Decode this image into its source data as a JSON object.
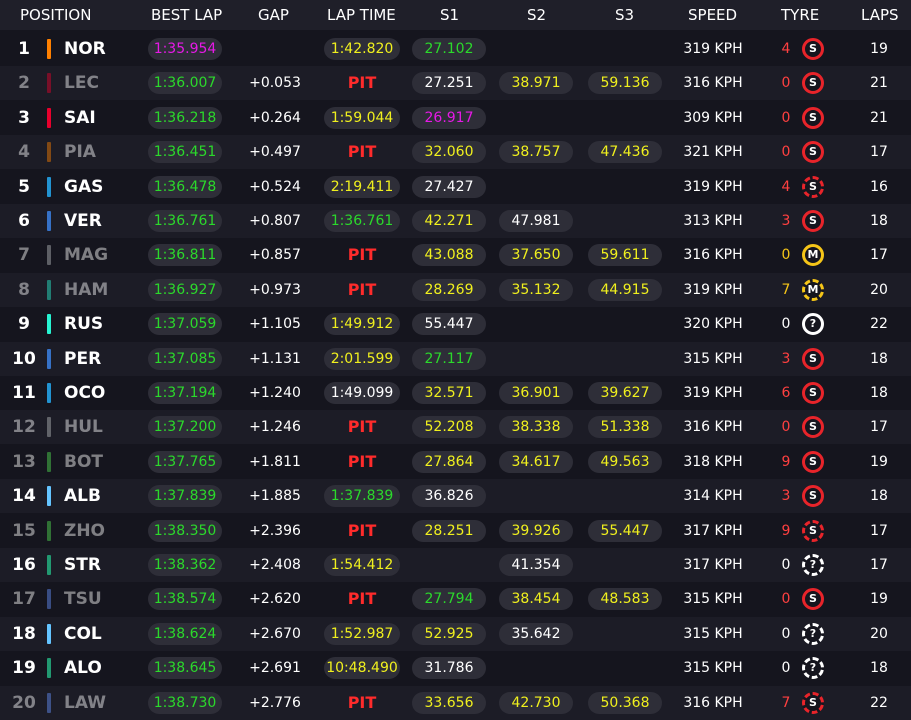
{
  "colors": {
    "purple": "#e619e6",
    "green": "#2bd92b",
    "yellow": "#f0f01e",
    "white": "#ffffff",
    "pit_red": "#ff2b2b",
    "soft": "#e8242a",
    "medium": "#f5c518",
    "unknown": "#ffffff"
  },
  "headers": {
    "position": "POSITION",
    "best_lap": "BEST LAP",
    "gap": "GAP",
    "lap_time": "LAP TIME",
    "s1": "S1",
    "s2": "S2",
    "s3": "S3",
    "speed": "SPEED",
    "tyre": "TYRE",
    "laps": "LAPS"
  },
  "rows": [
    {
      "pos": "1",
      "code": "NOR",
      "team_color": "#ff8000",
      "faded": false,
      "best_lap": "1:35.954",
      "best_lap_color": "purple",
      "gap": "",
      "lap_time": "1:42.820",
      "lap_time_color": "yellow",
      "pit": "",
      "s1": "27.102",
      "s1_color": "green",
      "s2": "",
      "s2_color": "white",
      "s3": "",
      "s3_color": "white",
      "speed": "319 KPH",
      "tyre_age": "4",
      "tyre_age_color": "#ff4040",
      "tyre": "S",
      "tyre_type": "soft",
      "tyre_status": "full",
      "laps": "19"
    },
    {
      "pos": "2",
      "code": "LEC",
      "team_color": "#e8002d",
      "faded": true,
      "best_lap": "1:36.007",
      "best_lap_color": "green",
      "gap": "+0.053",
      "lap_time": "",
      "lap_time_color": "white",
      "pit": "PIT",
      "s1": "27.251",
      "s1_color": "white",
      "s2": "38.971",
      "s2_color": "yellow",
      "s3": "59.136",
      "s3_color": "yellow",
      "speed": "316 KPH",
      "tyre_age": "0",
      "tyre_age_color": "#ff4040",
      "tyre": "S",
      "tyre_type": "soft",
      "tyre_status": "full",
      "laps": "21"
    },
    {
      "pos": "3",
      "code": "SAI",
      "team_color": "#e8002d",
      "faded": false,
      "best_lap": "1:36.218",
      "best_lap_color": "green",
      "gap": "+0.264",
      "lap_time": "1:59.044",
      "lap_time_color": "yellow",
      "pit": "",
      "s1": "26.917",
      "s1_color": "purple",
      "s2": "",
      "s2_color": "white",
      "s3": "",
      "s3_color": "white",
      "speed": "309 KPH",
      "tyre_age": "0",
      "tyre_age_color": "#ff4040",
      "tyre": "S",
      "tyre_type": "soft",
      "tyre_status": "full",
      "laps": "21"
    },
    {
      "pos": "4",
      "code": "PIA",
      "team_color": "#ff8000",
      "faded": true,
      "best_lap": "1:36.451",
      "best_lap_color": "green",
      "gap": "+0.497",
      "lap_time": "",
      "lap_time_color": "white",
      "pit": "PIT",
      "s1": "32.060",
      "s1_color": "yellow",
      "s2": "38.757",
      "s2_color": "yellow",
      "s3": "47.436",
      "s3_color": "yellow",
      "speed": "321 KPH",
      "tyre_age": "0",
      "tyre_age_color": "#ff4040",
      "tyre": "S",
      "tyre_type": "soft",
      "tyre_status": "full",
      "laps": "17"
    },
    {
      "pos": "5",
      "code": "GAS",
      "team_color": "#2293d1",
      "faded": false,
      "best_lap": "1:36.478",
      "best_lap_color": "green",
      "gap": "+0.524",
      "lap_time": "2:19.411",
      "lap_time_color": "yellow",
      "pit": "",
      "s1": "27.427",
      "s1_color": "white",
      "s2": "",
      "s2_color": "white",
      "s3": "",
      "s3_color": "white",
      "speed": "319 KPH",
      "tyre_age": "4",
      "tyre_age_color": "#ff4040",
      "tyre": "S",
      "tyre_type": "soft",
      "tyre_status": "partial",
      "laps": "16"
    },
    {
      "pos": "6",
      "code": "VER",
      "team_color": "#3671c6",
      "faded": false,
      "best_lap": "1:36.761",
      "best_lap_color": "green",
      "gap": "+0.807",
      "lap_time": "1:36.761",
      "lap_time_color": "green",
      "pit": "",
      "s1": "42.271",
      "s1_color": "yellow",
      "s2": "47.981",
      "s2_color": "white",
      "s3": "",
      "s3_color": "white",
      "speed": "313 KPH",
      "tyre_age": "3",
      "tyre_age_color": "#ff4040",
      "tyre": "S",
      "tyre_type": "soft",
      "tyre_status": "full",
      "laps": "18"
    },
    {
      "pos": "7",
      "code": "MAG",
      "team_color": "#b6babd",
      "faded": true,
      "best_lap": "1:36.811",
      "best_lap_color": "green",
      "gap": "+0.857",
      "lap_time": "",
      "lap_time_color": "white",
      "pit": "PIT",
      "s1": "43.088",
      "s1_color": "yellow",
      "s2": "37.650",
      "s2_color": "yellow",
      "s3": "59.611",
      "s3_color": "yellow",
      "speed": "316 KPH",
      "tyre_age": "0",
      "tyre_age_color": "#f5c518",
      "tyre": "M",
      "tyre_type": "medium",
      "tyre_status": "full",
      "laps": "17"
    },
    {
      "pos": "8",
      "code": "HAM",
      "team_color": "#27f4d2",
      "faded": true,
      "best_lap": "1:36.927",
      "best_lap_color": "green",
      "gap": "+0.973",
      "lap_time": "",
      "lap_time_color": "white",
      "pit": "PIT",
      "s1": "28.269",
      "s1_color": "yellow",
      "s2": "35.132",
      "s2_color": "yellow",
      "s3": "44.915",
      "s3_color": "yellow",
      "speed": "319 KPH",
      "tyre_age": "7",
      "tyre_age_color": "#f5c518",
      "tyre": "M",
      "tyre_type": "medium",
      "tyre_status": "partial",
      "laps": "20"
    },
    {
      "pos": "9",
      "code": "RUS",
      "team_color": "#27f4d2",
      "faded": false,
      "best_lap": "1:37.059",
      "best_lap_color": "green",
      "gap": "+1.105",
      "lap_time": "1:49.912",
      "lap_time_color": "yellow",
      "pit": "",
      "s1": "55.447",
      "s1_color": "white",
      "s2": "",
      "s2_color": "white",
      "s3": "",
      "s3_color": "white",
      "speed": "320 KPH",
      "tyre_age": "0",
      "tyre_age_color": "#ffffff",
      "tyre": "?",
      "tyre_type": "unknown",
      "tyre_status": "full",
      "laps": "22"
    },
    {
      "pos": "10",
      "code": "PER",
      "team_color": "#3671c6",
      "faded": false,
      "best_lap": "1:37.085",
      "best_lap_color": "green",
      "gap": "+1.131",
      "lap_time": "2:01.599",
      "lap_time_color": "yellow",
      "pit": "",
      "s1": "27.117",
      "s1_color": "green",
      "s2": "",
      "s2_color": "white",
      "s3": "",
      "s3_color": "white",
      "speed": "315 KPH",
      "tyre_age": "3",
      "tyre_age_color": "#ff4040",
      "tyre": "S",
      "tyre_type": "soft",
      "tyre_status": "full",
      "laps": "18"
    },
    {
      "pos": "11",
      "code": "OCO",
      "team_color": "#2293d1",
      "faded": false,
      "best_lap": "1:37.194",
      "best_lap_color": "green",
      "gap": "+1.240",
      "lap_time": "1:49.099",
      "lap_time_color": "white",
      "pit": "",
      "s1": "32.571",
      "s1_color": "yellow",
      "s2": "36.901",
      "s2_color": "yellow",
      "s3": "39.627",
      "s3_color": "yellow",
      "speed": "319 KPH",
      "tyre_age": "6",
      "tyre_age_color": "#ff4040",
      "tyre": "S",
      "tyre_type": "soft",
      "tyre_status": "full",
      "laps": "18"
    },
    {
      "pos": "12",
      "code": "HUL",
      "team_color": "#b6babd",
      "faded": true,
      "best_lap": "1:37.200",
      "best_lap_color": "green",
      "gap": "+1.246",
      "lap_time": "",
      "lap_time_color": "white",
      "pit": "PIT",
      "s1": "52.208",
      "s1_color": "yellow",
      "s2": "38.338",
      "s2_color": "yellow",
      "s3": "51.338",
      "s3_color": "yellow",
      "speed": "316 KPH",
      "tyre_age": "0",
      "tyre_age_color": "#ff4040",
      "tyre": "S",
      "tyre_type": "soft",
      "tyre_status": "full",
      "laps": "17"
    },
    {
      "pos": "13",
      "code": "BOT",
      "team_color": "#52e252",
      "faded": true,
      "best_lap": "1:37.765",
      "best_lap_color": "green",
      "gap": "+1.811",
      "lap_time": "",
      "lap_time_color": "white",
      "pit": "PIT",
      "s1": "27.864",
      "s1_color": "yellow",
      "s2": "34.617",
      "s2_color": "yellow",
      "s3": "49.563",
      "s3_color": "yellow",
      "speed": "318 KPH",
      "tyre_age": "9",
      "tyre_age_color": "#ff4040",
      "tyre": "S",
      "tyre_type": "soft",
      "tyre_status": "full",
      "laps": "19"
    },
    {
      "pos": "14",
      "code": "ALB",
      "team_color": "#64c4ff",
      "faded": false,
      "best_lap": "1:37.839",
      "best_lap_color": "green",
      "gap": "+1.885",
      "lap_time": "1:37.839",
      "lap_time_color": "green",
      "pit": "",
      "s1": "36.826",
      "s1_color": "white",
      "s2": "",
      "s2_color": "white",
      "s3": "",
      "s3_color": "white",
      "speed": "314 KPH",
      "tyre_age": "3",
      "tyre_age_color": "#ff4040",
      "tyre": "S",
      "tyre_type": "soft",
      "tyre_status": "full",
      "laps": "18"
    },
    {
      "pos": "15",
      "code": "ZHO",
      "team_color": "#52e252",
      "faded": true,
      "best_lap": "1:38.350",
      "best_lap_color": "green",
      "gap": "+2.396",
      "lap_time": "",
      "lap_time_color": "white",
      "pit": "PIT",
      "s1": "28.251",
      "s1_color": "yellow",
      "s2": "39.926",
      "s2_color": "yellow",
      "s3": "55.447",
      "s3_color": "yellow",
      "speed": "317 KPH",
      "tyre_age": "9",
      "tyre_age_color": "#ff4040",
      "tyre": "S",
      "tyre_type": "soft",
      "tyre_status": "partial",
      "laps": "17"
    },
    {
      "pos": "16",
      "code": "STR",
      "team_color": "#229971",
      "faded": false,
      "best_lap": "1:38.362",
      "best_lap_color": "green",
      "gap": "+2.408",
      "lap_time": "1:54.412",
      "lap_time_color": "yellow",
      "pit": "",
      "s1": "",
      "s1_color": "white",
      "s2": "41.354",
      "s2_color": "white",
      "s3": "",
      "s3_color": "white",
      "speed": "317 KPH",
      "tyre_age": "0",
      "tyre_age_color": "#ffffff",
      "tyre": "?",
      "tyre_type": "unknown",
      "tyre_status": "partial",
      "laps": "17"
    },
    {
      "pos": "17",
      "code": "TSU",
      "team_color": "#6692ff",
      "faded": true,
      "best_lap": "1:38.574",
      "best_lap_color": "green",
      "gap": "+2.620",
      "lap_time": "",
      "lap_time_color": "white",
      "pit": "PIT",
      "s1": "27.794",
      "s1_color": "green",
      "s2": "38.454",
      "s2_color": "yellow",
      "s3": "48.583",
      "s3_color": "yellow",
      "speed": "315 KPH",
      "tyre_age": "0",
      "tyre_age_color": "#ff4040",
      "tyre": "S",
      "tyre_type": "soft",
      "tyre_status": "full",
      "laps": "19"
    },
    {
      "pos": "18",
      "code": "COL",
      "team_color": "#64c4ff",
      "faded": false,
      "best_lap": "1:38.624",
      "best_lap_color": "green",
      "gap": "+2.670",
      "lap_time": "1:52.987",
      "lap_time_color": "yellow",
      "pit": "",
      "s1": "52.925",
      "s1_color": "yellow",
      "s2": "35.642",
      "s2_color": "white",
      "s3": "",
      "s3_color": "white",
      "speed": "315 KPH",
      "tyre_age": "0",
      "tyre_age_color": "#ffffff",
      "tyre": "?",
      "tyre_type": "unknown",
      "tyre_status": "partial",
      "laps": "20"
    },
    {
      "pos": "19",
      "code": "ALO",
      "team_color": "#229971",
      "faded": false,
      "best_lap": "1:38.645",
      "best_lap_color": "green",
      "gap": "+2.691",
      "lap_time": "10:48.490",
      "lap_time_color": "yellow",
      "pit": "",
      "s1": "31.786",
      "s1_color": "white",
      "s2": "",
      "s2_color": "white",
      "s3": "",
      "s3_color": "white",
      "speed": "315 KPH",
      "tyre_age": "0",
      "tyre_age_color": "#ffffff",
      "tyre": "?",
      "tyre_type": "unknown",
      "tyre_status": "partial",
      "laps": "18"
    },
    {
      "pos": "20",
      "code": "LAW",
      "team_color": "#6692ff",
      "faded": true,
      "best_lap": "1:38.730",
      "best_lap_color": "green",
      "gap": "+2.776",
      "lap_time": "",
      "lap_time_color": "white",
      "pit": "PIT",
      "s1": "33.656",
      "s1_color": "yellow",
      "s2": "42.730",
      "s2_color": "yellow",
      "s3": "50.368",
      "s3_color": "yellow",
      "speed": "316 KPH",
      "tyre_age": "7",
      "tyre_age_color": "#ff4040",
      "tyre": "S",
      "tyre_type": "soft",
      "tyre_status": "partial",
      "laps": "22"
    }
  ]
}
